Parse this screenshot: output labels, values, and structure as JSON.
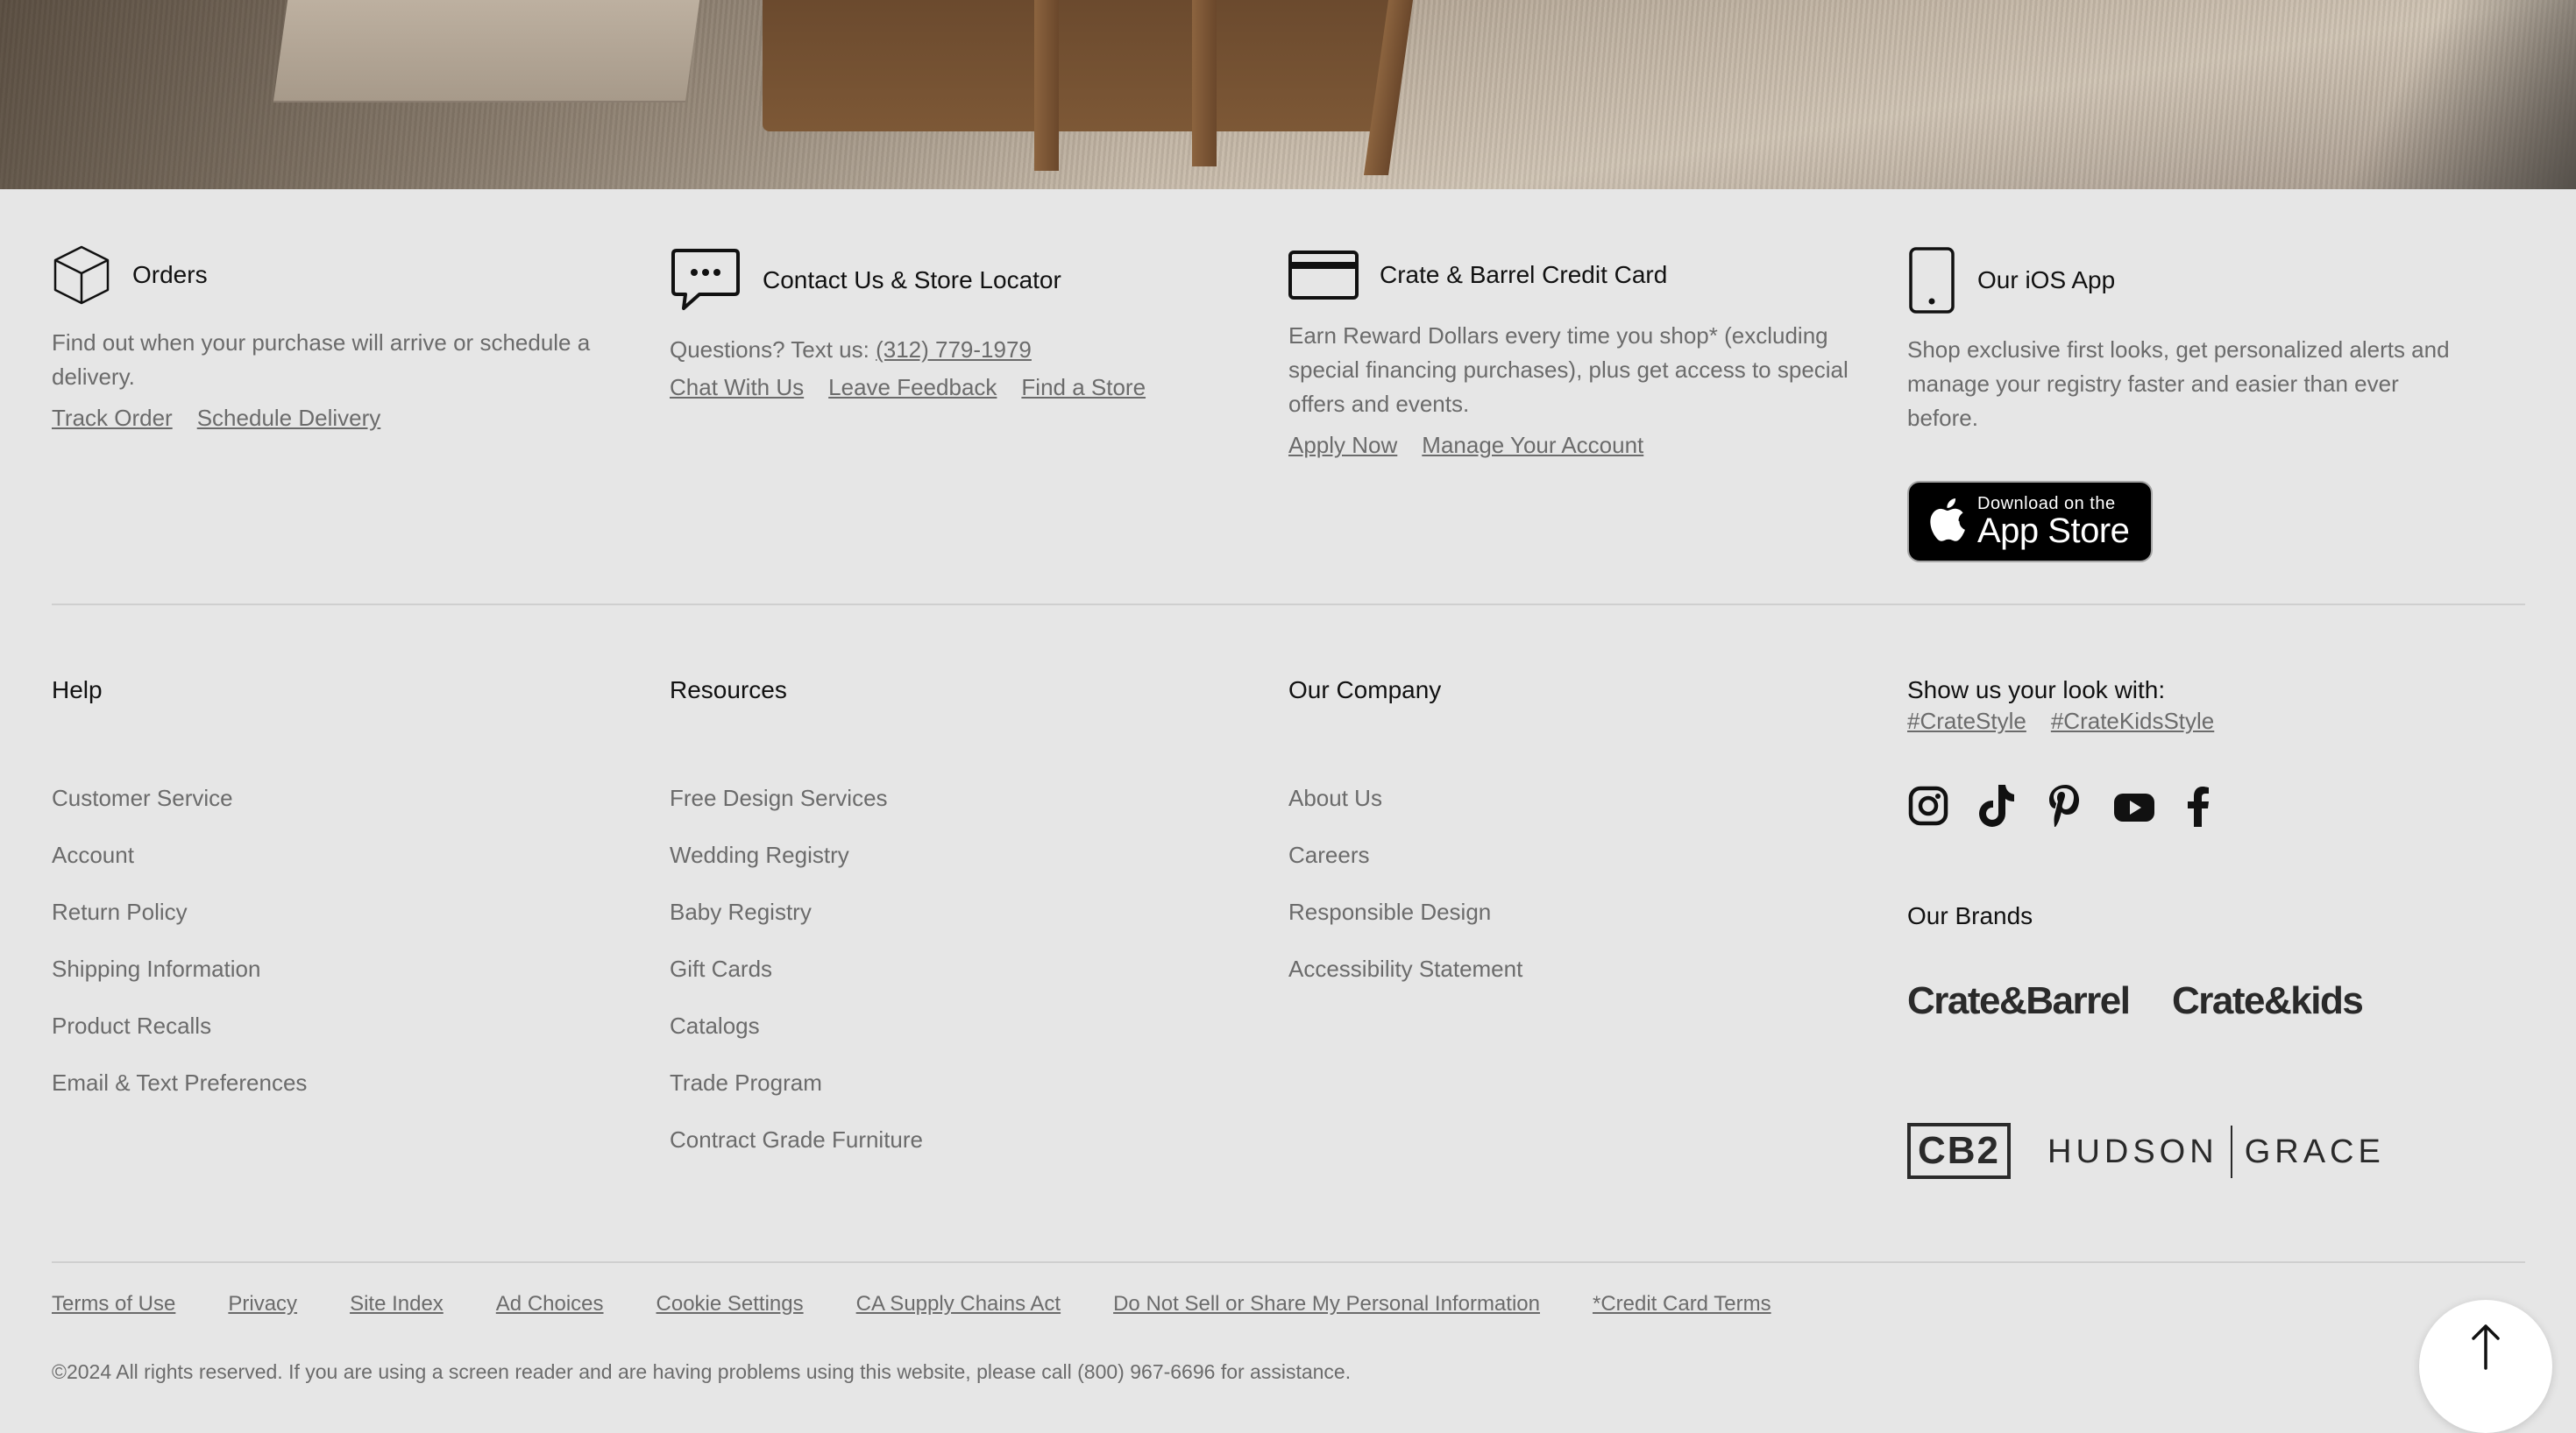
{
  "orders": {
    "title": "Orders",
    "description": "Find out when your purchase will arrive or schedule a delivery.",
    "links": [
      "Track Order",
      "Schedule Delivery"
    ],
    "icon": "box-icon"
  },
  "contact": {
    "title": "Contact Us & Store Locator",
    "text_prefix": "Questions? Text us: ",
    "phone": "(312) 779-1979",
    "links": [
      "Chat With Us",
      "Leave Feedback",
      "Find a Store"
    ],
    "icon": "chat-bubble-icon"
  },
  "credit": {
    "title": "Crate & Barrel Credit Card",
    "description": "Earn Reward Dollars every time you shop* (excluding special financing purchases), plus get access to special offers and events.",
    "links": [
      "Apply Now",
      "Manage Your Account"
    ],
    "icon": "credit-card-icon"
  },
  "ios": {
    "title": "Our iOS App",
    "description": "Shop exclusive first looks, get personalized alerts and manage your registry faster and easier than ever before.",
    "badge_small": "Download on the",
    "badge_big": "App Store",
    "icon": "phone-icon"
  },
  "columns": {
    "help": {
      "heading": "Help",
      "items": [
        "Customer Service",
        "Account",
        "Return Policy",
        "Shipping Information",
        "Product Recalls",
        "Email & Text Preferences"
      ]
    },
    "resources": {
      "heading": "Resources",
      "items": [
        "Free Design Services",
        "Wedding Registry",
        "Baby Registry",
        "Gift Cards",
        "Catalogs",
        "Trade Program",
        "Contract Grade Furniture"
      ]
    },
    "company": {
      "heading": "Our Company",
      "items": [
        "About Us",
        "Careers",
        "Responsible Design",
        "Accessibility Statement"
      ]
    }
  },
  "social": {
    "heading": "Show us your look with:",
    "hashtags": [
      "#CrateStyle",
      "#CrateKidsStyle"
    ],
    "icons": [
      "instagram-icon",
      "tiktok-icon",
      "pinterest-icon",
      "youtube-icon",
      "facebook-icon"
    ]
  },
  "brands": {
    "heading": "Our Brands",
    "names": [
      "Crate&Barrel",
      "Crate&kids",
      "CB2",
      "HUDSON",
      "GRACE"
    ]
  },
  "legal": {
    "links": [
      "Terms of Use",
      "Privacy",
      "Site Index",
      "Ad Choices",
      "Cookie Settings",
      "CA Supply Chains Act",
      "Do Not Sell or Share My Personal Information",
      "*Credit Card Terms"
    ],
    "copyright": "©2024 All rights reserved. If you are using a screen reader and are having problems using this website, please call (800) 967-6696 for assistance."
  },
  "colors": {
    "background": "#e6e6e6",
    "text_muted": "#6b6b6b",
    "text_dark": "#111111"
  }
}
